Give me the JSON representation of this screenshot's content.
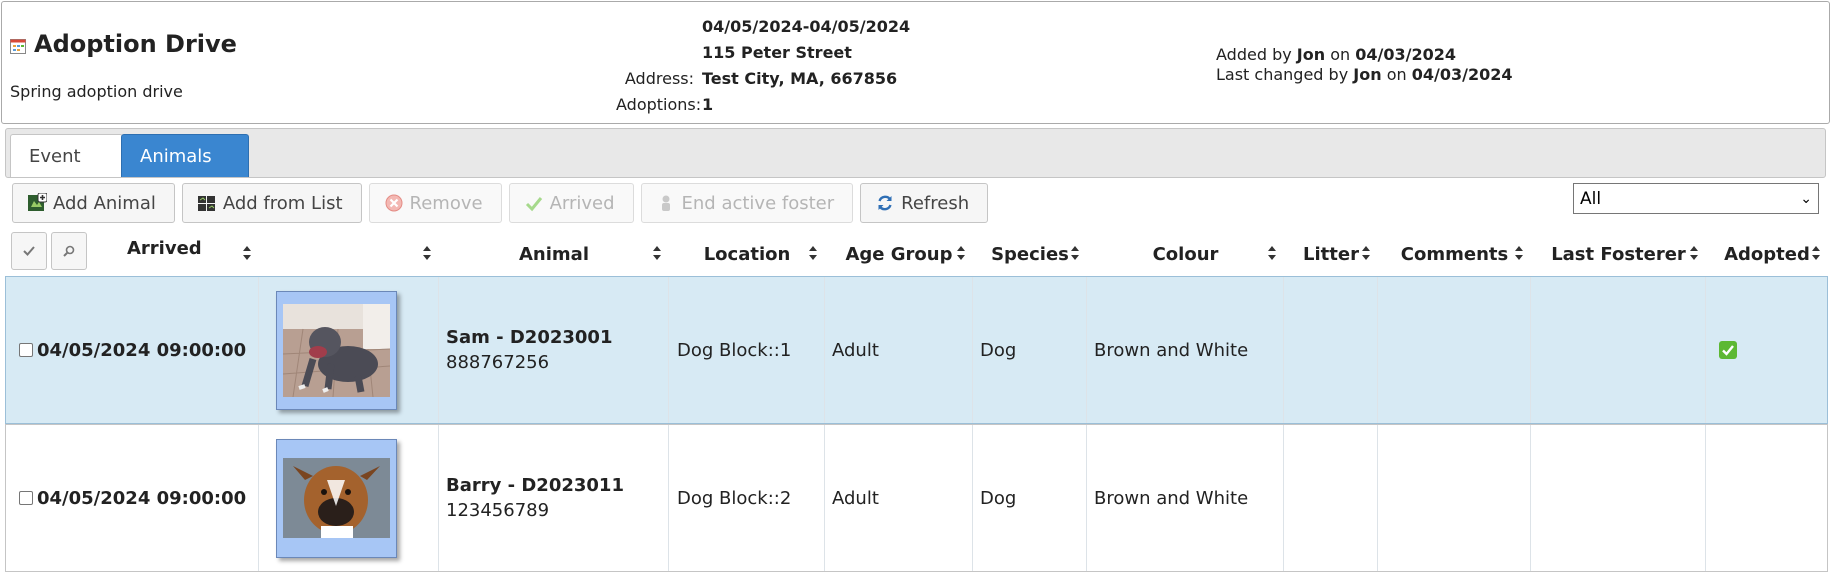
{
  "header": {
    "title": "Adoption Drive",
    "description": "Spring adoption drive",
    "dates": "04/05/2024-04/05/2024",
    "address_line1": "115 Peter Street",
    "address_label": "Address:",
    "address_line2": "Test City, MA, 667856",
    "adoptions_label": "Adoptions:",
    "adoptions_value": "1",
    "added_by_prefix": "Added by",
    "added_by_user": "Jon",
    "added_on_word": "on",
    "added_date": "04/03/2024",
    "changed_by_prefix": "Last changed by",
    "changed_by_user": "Jon",
    "changed_on_word": "on",
    "changed_date": "04/03/2024"
  },
  "tabs": [
    {
      "label": "Event",
      "active": false
    },
    {
      "label": "Animals",
      "active": true
    }
  ],
  "toolbar": {
    "add_animal": "Add Animal",
    "add_from_list": "Add from List",
    "remove": "Remove",
    "arrived": "Arrived",
    "end_active_foster": "End active foster",
    "refresh": "Refresh"
  },
  "filter": {
    "selected": "All"
  },
  "columns": {
    "arrived": "Arrived",
    "image": "",
    "animal": "Animal",
    "location": "Location",
    "age_group": "Age Group",
    "species": "Species",
    "colour": "Colour",
    "litter": "Litter",
    "comments": "Comments",
    "last_fosterer": "Last Fosterer",
    "adopted": "Adopted"
  },
  "rows": [
    {
      "arrived": "04/05/2024 09:00:00",
      "animal_name": "Sam - D2023001",
      "animal_code": "888767256",
      "location": "Dog Block::1",
      "age_group": "Adult",
      "species": "Dog",
      "colour": "Brown and White",
      "litter": "",
      "comments": "",
      "last_fosterer": "",
      "adopted": true,
      "selected": true
    },
    {
      "arrived": "04/05/2024 09:00:00",
      "animal_name": "Barry - D2023011",
      "animal_code": "123456789",
      "location": "Dog Block::2",
      "age_group": "Adult",
      "species": "Dog",
      "colour": "Brown and White",
      "litter": "",
      "comments": "",
      "last_fosterer": "",
      "adopted": false,
      "selected": false
    }
  ],
  "colors": {
    "accent": "#3a86d0",
    "selected_row": "#d7eaf4",
    "thumb_bg": "#a7c6f5",
    "adopted_check": "#5cb833"
  }
}
